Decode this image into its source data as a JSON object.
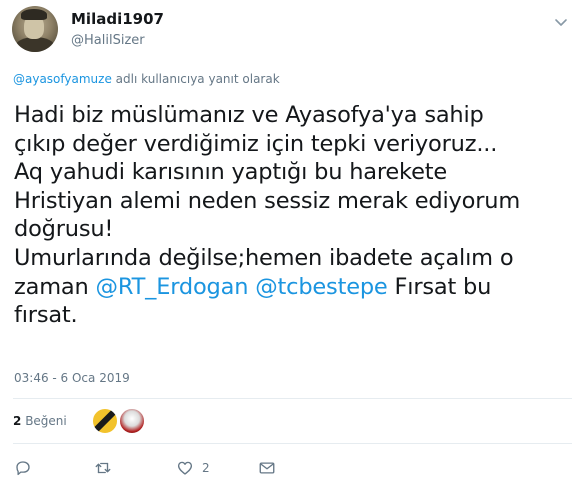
{
  "author": {
    "display_name": "Miladi1907",
    "handle": "@HalilSizer"
  },
  "reply_context": {
    "mention": "@ayasofyamuze",
    "suffix": " adlı kullanıcıya yanıt olarak"
  },
  "tweet": {
    "lines": [
      "Hadi biz müslümanız ve Ayasofya'ya sahip",
      "çıkıp değer verdiğimiz için tepki veriyoruz...",
      "Aq yahudi karısının yaptığı bu harekete",
      "Hristiyan alemi neden sessiz merak ediyorum",
      "doğrusu!",
      "Umurlarında değilse;hemen ibadete açalım o"
    ],
    "line7_prefix": "zaman ",
    "mention1": "@RT_Erdogan",
    "space": " ",
    "mention2": "@tcbestepe",
    "line7_suffix": " Fırsat bu",
    "line8": "fırsat."
  },
  "timestamp": "03:46 - 6 Oca 2019",
  "likes": {
    "count": "2",
    "label": "Beğeni"
  },
  "actions": {
    "reply_icon": "reply-icon",
    "retweet_icon": "retweet-icon",
    "like_icon": "heart-icon",
    "like_count": "2",
    "dm_icon": "envelope-icon"
  },
  "colors": {
    "link": "#1b95e0",
    "secondary_text": "#657786",
    "primary_text": "#14171a",
    "divider": "#e6ecf0"
  }
}
